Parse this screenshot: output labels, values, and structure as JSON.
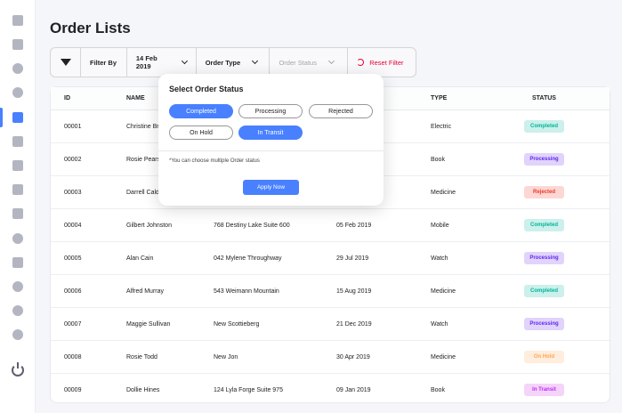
{
  "page": {
    "title": "Order Lists"
  },
  "sidebar": {
    "items": [
      {
        "icon": "dashboard-icon"
      },
      {
        "icon": "cube-icon"
      },
      {
        "icon": "heart-icon"
      },
      {
        "icon": "chat-icon"
      },
      {
        "icon": "layers-icon",
        "active": true
      },
      {
        "icon": "table-icon"
      },
      {
        "icon": "document-icon"
      },
      {
        "icon": "calendar-icon"
      },
      {
        "icon": "clipboard-icon"
      },
      {
        "icon": "team-icon"
      },
      {
        "icon": "card-icon"
      },
      {
        "icon": "pie-icon"
      },
      {
        "icon": "user-icon"
      },
      {
        "icon": "settings-icon"
      }
    ],
    "accent": "#4880ff"
  },
  "filter": {
    "label": "Filter By",
    "date": "14 Feb 2019",
    "order_type": "Order Type",
    "order_status": "Order Status",
    "reset": "Reset Filter"
  },
  "table": {
    "headers": {
      "id": "ID",
      "name": "NAME",
      "address": "",
      "date": "",
      "type": "TYPE",
      "status": "STATUS"
    },
    "rows": [
      {
        "id": "00001",
        "name": "Christine Br",
        "address": "",
        "date": "",
        "type": "Electric",
        "status": "Completed"
      },
      {
        "id": "00002",
        "name": "Rosie Pearso",
        "address": "",
        "date": "",
        "type": "Book",
        "status": "Processing"
      },
      {
        "id": "00003",
        "name": "Darrell Cald",
        "address": "",
        "date": "",
        "type": "Medicine",
        "status": "Rejected"
      },
      {
        "id": "00004",
        "name": "Gilbert Johnston",
        "address": "768 Destiny Lake Suite 600",
        "date": "05 Feb 2019",
        "type": "Mobile",
        "status": "Completed"
      },
      {
        "id": "00005",
        "name": "Alan Cain",
        "address": "042 Mylene Throughway",
        "date": "29 Jul 2019",
        "type": "Watch",
        "status": "Processing"
      },
      {
        "id": "00006",
        "name": "Alfred Murray",
        "address": "543 Weimann Mountain",
        "date": "15 Aug 2019",
        "type": "Medicine",
        "status": "Completed"
      },
      {
        "id": "00007",
        "name": "Maggie Sullivan",
        "address": "New Scottieberg",
        "date": "21 Dec 2019",
        "type": "Watch",
        "status": "Processing"
      },
      {
        "id": "00008",
        "name": "Rosie Todd",
        "address": "New Jon",
        "date": "30 Apr 2019",
        "type": "Medicine",
        "status": "On Hold"
      },
      {
        "id": "00009",
        "name": "Dollie Hines",
        "address": "124 Lyla Forge Suite 975",
        "date": "09 Jan 2019",
        "type": "Book",
        "status": "In Transit"
      }
    ]
  },
  "popup": {
    "title": "Select Order Status",
    "options": [
      {
        "label": "Completed",
        "selected": true
      },
      {
        "label": "Processing",
        "selected": false
      },
      {
        "label": "Rejected",
        "selected": false
      },
      {
        "label": "On Hold",
        "selected": false
      },
      {
        "label": "In Transit",
        "selected": true
      }
    ],
    "note": "*You can choose multiple Order status",
    "apply": "Apply Now"
  }
}
